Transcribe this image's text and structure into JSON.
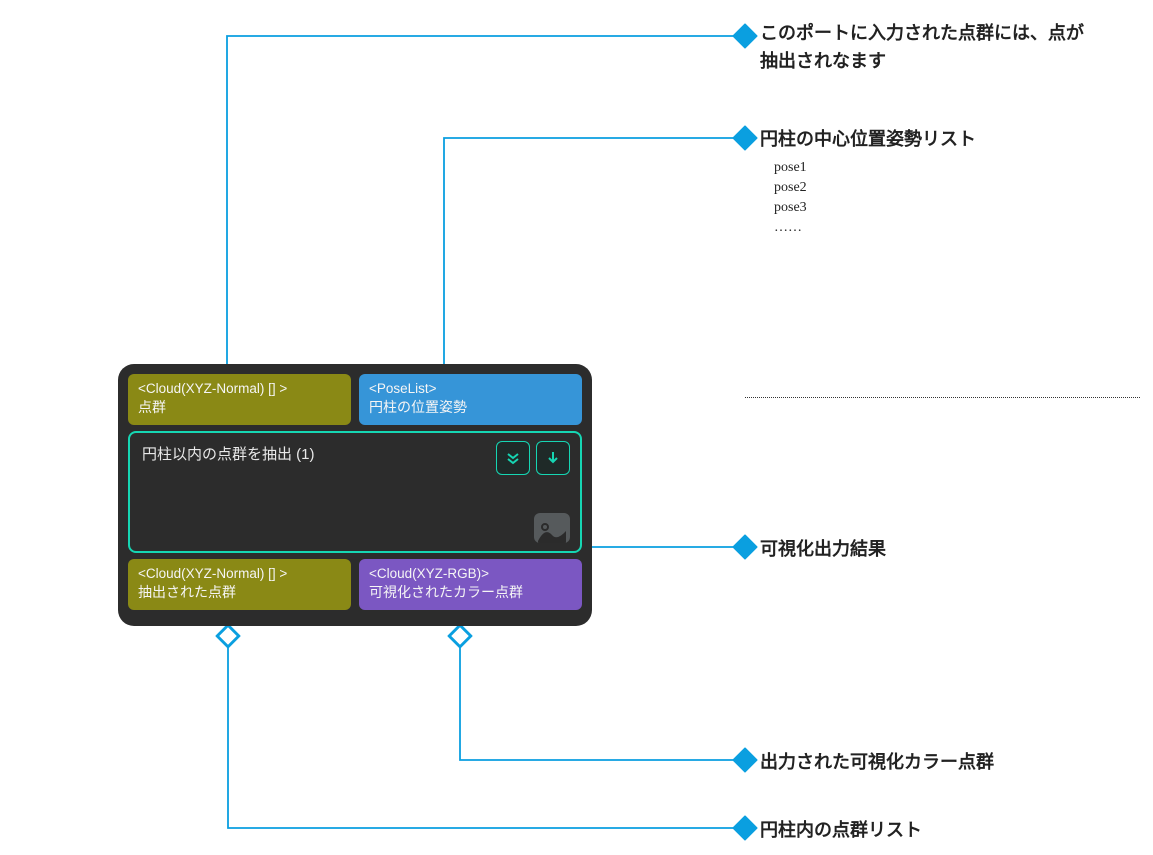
{
  "node": {
    "title": "円柱以内の点群を抽出 (1)",
    "inputs": [
      {
        "type": "<Cloud(XYZ-Normal) [] >",
        "label": "点群"
      },
      {
        "type": "<PoseList>",
        "label": "円柱の位置姿勢"
      }
    ],
    "outputs": [
      {
        "type": "<Cloud(XYZ-Normal) [] >",
        "label": "抽出された点群"
      },
      {
        "type": "<Cloud(XYZ-RGB)>",
        "label": "可視化されたカラー点群"
      }
    ]
  },
  "annotations": {
    "input_cloud": "このポートに入力された点群には、点が抽出されなます",
    "pose_list": "円柱の中心位置姿勢リスト",
    "pose_items": [
      "pose1",
      "pose2",
      "pose3",
      "……"
    ],
    "viz_result": "可視化出力結果",
    "viz_cloud": "出力された可視化カラー点群",
    "inside_cloud": "円柱内の点群リスト"
  },
  "leader_color": "#0a9fe0"
}
